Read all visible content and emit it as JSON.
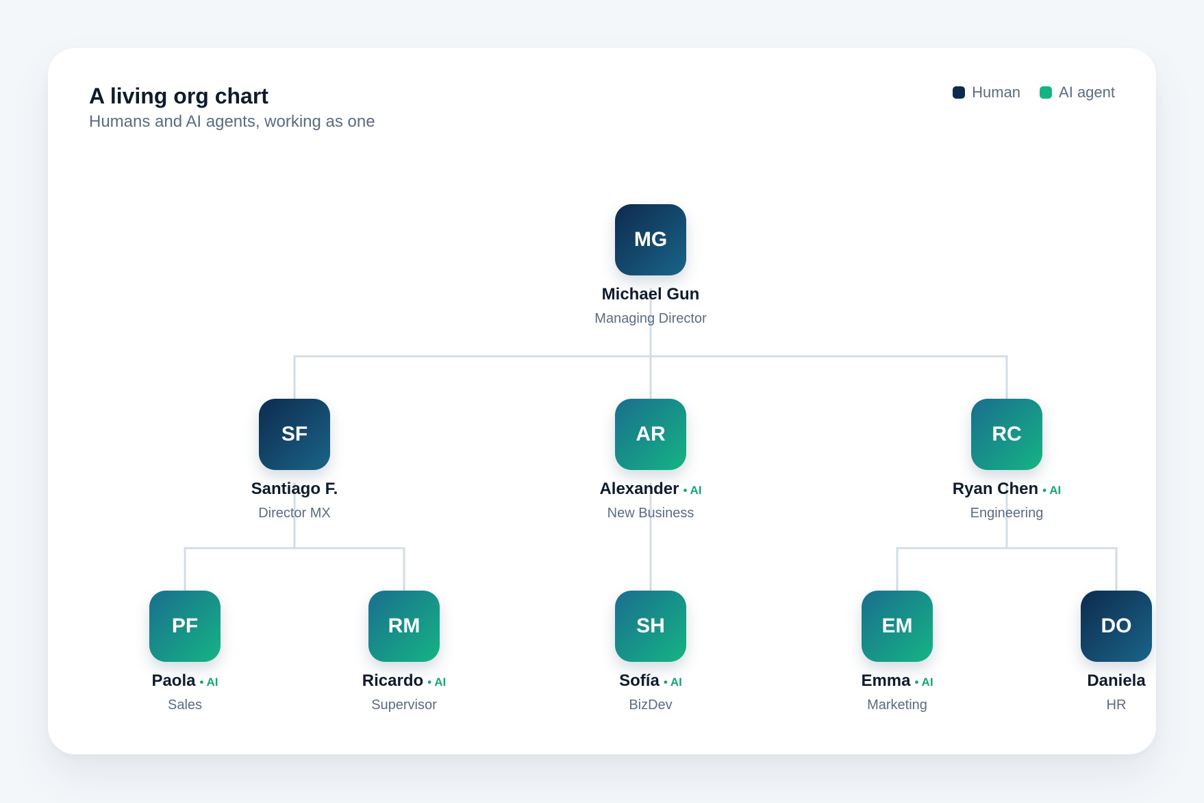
{
  "header": {
    "title": "A living org chart",
    "subtitle": "Humans and AI agents, working as one"
  },
  "legend": [
    {
      "label": "Human",
      "color": "#0d2b4e"
    },
    {
      "label": "AI agent",
      "color": "#15b484"
    }
  ],
  "ai_tag": "• AI",
  "nodes": [
    {
      "id": "mg",
      "initials": "MG",
      "name": "Michael Gun",
      "role": "Managing Director",
      "type": "human"
    },
    {
      "id": "sf",
      "initials": "SF",
      "name": "Santiago F.",
      "role": "Director MX",
      "type": "human"
    },
    {
      "id": "ar",
      "initials": "AR",
      "name": "Alexander",
      "role": "New Business",
      "type": "ai"
    },
    {
      "id": "rc",
      "initials": "RC",
      "name": "Ryan Chen",
      "role": "Engineering",
      "type": "ai"
    },
    {
      "id": "pf",
      "initials": "PF",
      "name": "Paola",
      "role": "Sales",
      "type": "ai"
    },
    {
      "id": "rm",
      "initials": "RM",
      "name": "Ricardo",
      "role": "Supervisor",
      "type": "ai"
    },
    {
      "id": "sh",
      "initials": "SH",
      "name": "Sofía",
      "role": "BizDev",
      "type": "ai"
    },
    {
      "id": "em",
      "initials": "EM",
      "name": "Emma",
      "role": "Marketing",
      "type": "ai"
    },
    {
      "id": "do",
      "initials": "DO",
      "name": "Daniela",
      "role": "HR",
      "type": "human"
    }
  ],
  "edges": [
    [
      "mg",
      "sf"
    ],
    [
      "mg",
      "ar"
    ],
    [
      "mg",
      "rc"
    ],
    [
      "sf",
      "pf"
    ],
    [
      "sf",
      "rm"
    ],
    [
      "ar",
      "sh"
    ],
    [
      "rc",
      "em"
    ],
    [
      "rc",
      "do"
    ]
  ]
}
